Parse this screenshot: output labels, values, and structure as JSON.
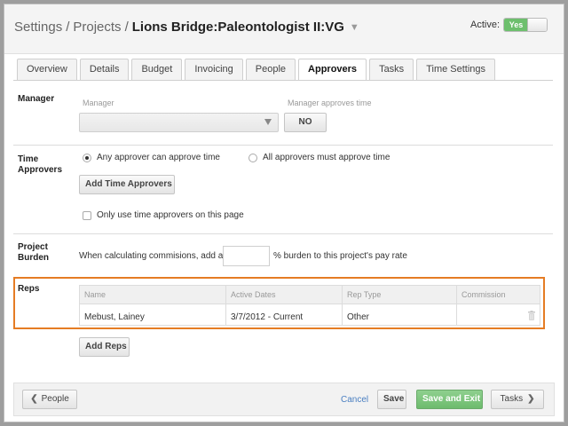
{
  "header": {
    "crumbs": [
      "Settings",
      "Projects"
    ],
    "separator": "/",
    "project_name": "Lions Bridge:Paleontologist II:VG",
    "caret": "▼",
    "active_label": "Active:",
    "active_value": "Yes"
  },
  "tabs": [
    {
      "label": "Overview",
      "active": false
    },
    {
      "label": "Details",
      "active": false
    },
    {
      "label": "Budget",
      "active": false
    },
    {
      "label": "Invoicing",
      "active": false
    },
    {
      "label": "People",
      "active": false
    },
    {
      "label": "Approvers",
      "active": true
    },
    {
      "label": "Tasks",
      "active": false
    },
    {
      "label": "Time Settings",
      "active": false
    }
  ],
  "manager": {
    "section_label": "Manager",
    "field_label": "Manager",
    "select_value": "",
    "approves_label": "Manager approves time",
    "approves_value": "NO"
  },
  "time_approvers": {
    "section_label_line1": "Time",
    "section_label_line2": "Approvers",
    "option_any": "Any approver can approve time",
    "option_all": "All approvers must approve time",
    "selected": "any",
    "add_button": "Add Time Approvers",
    "only_page_label": "Only use time approvers on this page",
    "only_page_checked": false
  },
  "burden": {
    "section_label_line1": "Project",
    "section_label_line2": "Burden",
    "text_before": "When calculating commisions, add a",
    "value": "",
    "text_after": "% burden to this project's pay rate"
  },
  "reps": {
    "section_label": "Reps",
    "columns": [
      "Name",
      "Active Dates",
      "Rep Type",
      "Commission"
    ],
    "rows": [
      {
        "name": "Mebust, Lainey",
        "active_dates": "3/7/2012 - Current",
        "rep_type": "Other",
        "commission": ""
      }
    ],
    "add_button": "Add Reps",
    "highlight_color": "#e57c24"
  },
  "footer": {
    "back_label": "People",
    "back_arrow": "❮",
    "cancel": "Cancel",
    "save": "Save",
    "save_exit": "Save and Exit",
    "next_label": "Tasks",
    "next_arrow": "❯"
  },
  "colors": {
    "accent_green": "#6dbb6d",
    "link_blue": "#4a7fc1"
  }
}
